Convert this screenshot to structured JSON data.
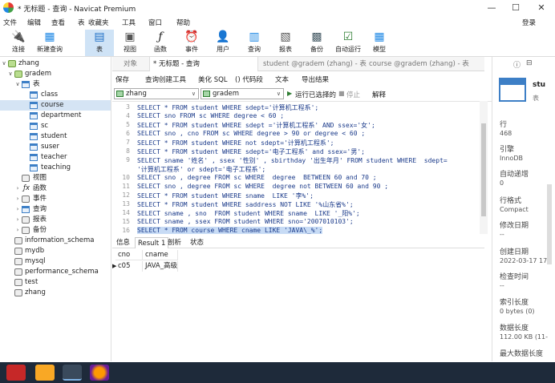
{
  "window": {
    "title": "* 无标题 - 查询 - Navicat Premium",
    "minimize": "—",
    "maximize": "☐",
    "close": "✕"
  },
  "menu": [
    "文件",
    "编辑",
    "查看",
    "表",
    "收藏夹",
    "工具",
    "窗口",
    "帮助"
  ],
  "login_label": "登录",
  "toolbar": [
    {
      "label": "连接",
      "icon": "connection-icon"
    },
    {
      "label": "新建查询",
      "icon": "new-query-icon"
    },
    {
      "label": "表",
      "icon": "table-icon"
    },
    {
      "label": "视图",
      "icon": "view-icon"
    },
    {
      "label": "函数",
      "icon": "function-icon"
    },
    {
      "label": "事件",
      "icon": "event-icon"
    },
    {
      "label": "用户",
      "icon": "user-icon"
    },
    {
      "label": "查询",
      "icon": "query-icon"
    },
    {
      "label": "报表",
      "icon": "report-icon"
    },
    {
      "label": "备份",
      "icon": "backup-icon"
    },
    {
      "label": "自动运行",
      "icon": "automation-icon"
    },
    {
      "label": "模型",
      "icon": "model-icon"
    }
  ],
  "tree": {
    "connection": "zhang",
    "database": "gradem",
    "tables_folder": "表",
    "tables": [
      "class",
      "course",
      "department",
      "sc",
      "student",
      "suser",
      "teacher",
      "teaching"
    ],
    "selected_table": "course",
    "folders": [
      "视图",
      "函数",
      "事件",
      "查询",
      "报表",
      "备份"
    ],
    "other_dbs": [
      "information_schema",
      "mydb",
      "mysql",
      "performance_schema",
      "test",
      "zhang"
    ]
  },
  "tabs": [
    {
      "label": "对象"
    },
    {
      "label": "* 无标题 - 查询"
    },
    {
      "label": "student @gradem (zhang) - 表"
    },
    {
      "label": "course @gradem (zhang) - 表"
    }
  ],
  "query_toolbar": {
    "save": "保存",
    "builder": "查询创建工具",
    "beautify": "美化 SQL",
    "snippet": "() 代码段",
    "text": "文本",
    "export": "导出结果"
  },
  "selectors": {
    "connection": "zhang",
    "database": "gradem"
  },
  "run_controls": {
    "run": "运行已选择的",
    "stop": "停止",
    "explain": "解释"
  },
  "editor_lines": [
    {
      "n": "3",
      "code": "SELECT * FROM student WHERE sdept='计算机工程系';"
    },
    {
      "n": "4",
      "code": "SELECT sno FROM sc WHERE degree < 60 ;"
    },
    {
      "n": "5",
      "code": "SELECT * FROM student WHERE sdept ='计算机工程系' AND ssex='女';"
    },
    {
      "n": "6",
      "code": "SELECT sno , cno FROM sc WHERE degree > 90 or degree < 60 ;"
    },
    {
      "n": "7",
      "code": "SELECT * FROM student WHERE not sdept='计算机工程系';"
    },
    {
      "n": "8",
      "code": "SELECT * FROM student WHERE sdept='电子工程系' and ssex='男';"
    },
    {
      "n": "9",
      "code": "SELECT sname '姓名' , ssex '性别' , sbirthday '出生年月' FROM student WHERE  sdept="
    },
    {
      "n": "",
      "code": "'计算机工程系' or sdept='电子工程系';"
    },
    {
      "n": "10",
      "code": "SELECT sno , degree FROM sc WHERE  degree  BETWEEN 60 and 70 ;"
    },
    {
      "n": "11",
      "code": "SELECT sno , degree FROM sc WHERE  degree not BETWEEN 60 and 90 ;"
    },
    {
      "n": "12",
      "code": "SELECT * FROM student WHERE sname  LIKE '李%';"
    },
    {
      "n": "13",
      "code": "SELECT * FROM student WHERE saddress NOT LIKE '%山东省%';"
    },
    {
      "n": "14",
      "code": "SELECT sname , sno  FROM student WHERE sname  LIKE '_阳%';"
    },
    {
      "n": "15",
      "code": "SELECT sname , ssex FROM student WHERE sno='2007010103';"
    },
    {
      "n": "16",
      "code": "SELECT * FROM course WHERE cname LIKE 'JAVA\\_%';"
    }
  ],
  "result_tabs": [
    "信息",
    "Result 1",
    "剖析",
    "状态"
  ],
  "result": {
    "columns": [
      "cno",
      "cname"
    ],
    "rows": [
      [
        "c05",
        "JAVA_高级"
      ]
    ]
  },
  "right_panel": {
    "name": "stu",
    "type": "表",
    "fields": [
      {
        "label": "行",
        "value": "468"
      },
      {
        "label": "引擎",
        "value": "InnoDB"
      },
      {
        "label": "自动递增",
        "value": "0"
      },
      {
        "label": "行格式",
        "value": "Compact"
      },
      {
        "label": "修改日期",
        "value": "--"
      },
      {
        "label": "创建日期",
        "value": "2022-03-17 17"
      },
      {
        "label": "检查时间",
        "value": "--"
      },
      {
        "label": "索引长度",
        "value": "0 bytes (0)"
      },
      {
        "label": "数据长度",
        "value": "112.00 KB (11-"
      },
      {
        "label": "最大数据长度",
        "value": ""
      }
    ]
  }
}
